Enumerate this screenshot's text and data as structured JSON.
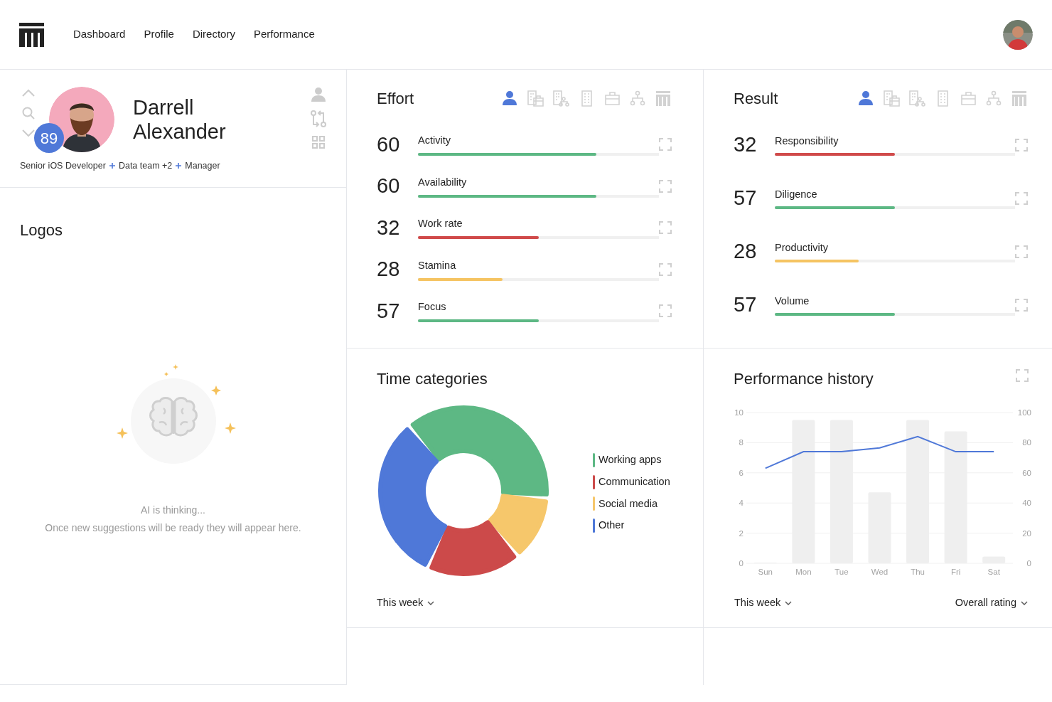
{
  "nav": {
    "items": [
      {
        "label": "Dashboard"
      },
      {
        "label": "Profile"
      },
      {
        "label": "Directory"
      },
      {
        "label": "Performance"
      }
    ]
  },
  "profile": {
    "name": "Darrell Alexander",
    "score": "89",
    "tags": [
      "Senior iOS Developer",
      "Data team +2",
      "Manager"
    ]
  },
  "logos": {
    "title": "Logos",
    "status": "AI is thinking...",
    "message": "Once new suggestions will be ready they will appear here."
  },
  "effort": {
    "title": "Effort",
    "views": [
      {
        "kind": "person",
        "selected": true
      },
      {
        "kind": "office-case",
        "selected": false
      },
      {
        "kind": "office-tree",
        "selected": false
      },
      {
        "kind": "building",
        "selected": false
      },
      {
        "kind": "briefcase",
        "selected": false
      },
      {
        "kind": "tree",
        "selected": false
      },
      {
        "kind": "logo",
        "selected": false
      }
    ],
    "metrics": [
      {
        "value": "60",
        "label": "Activity",
        "level": 0.74,
        "color": "#5db884"
      },
      {
        "value": "60",
        "label": "Availability",
        "level": 0.74,
        "color": "#5db884"
      },
      {
        "value": "32",
        "label": "Work rate",
        "level": 0.5,
        "color": "#d04a4a"
      },
      {
        "value": "28",
        "label": "Stamina",
        "level": 0.35,
        "color": "#f5c462"
      },
      {
        "value": "57",
        "label": "Focus",
        "level": 0.5,
        "color": "#5db884"
      }
    ]
  },
  "result": {
    "title": "Result",
    "views": [
      {
        "kind": "person",
        "selected": true
      },
      {
        "kind": "office-case",
        "selected": false
      },
      {
        "kind": "office-tree",
        "selected": false
      },
      {
        "kind": "building",
        "selected": false
      },
      {
        "kind": "briefcase",
        "selected": false
      },
      {
        "kind": "tree",
        "selected": false
      },
      {
        "kind": "logo",
        "selected": false
      }
    ],
    "metrics": [
      {
        "value": "32",
        "label": "Responsibility",
        "level": 0.5,
        "color": "#d04a4a"
      },
      {
        "value": "57",
        "label": "Diligence",
        "level": 0.5,
        "color": "#5db884"
      },
      {
        "value": "28",
        "label": "Productivity",
        "level": 0.35,
        "color": "#f5c462"
      },
      {
        "value": "57",
        "label": "Volume",
        "level": 0.5,
        "color": "#5db884"
      }
    ]
  },
  "time_categories": {
    "title": "Time categories",
    "legend": [
      {
        "label": "Working apps",
        "color": "#5db884"
      },
      {
        "label": "Communication",
        "color": "#cc4a4a"
      },
      {
        "label": "Social media",
        "color": "#f6c76b"
      },
      {
        "label": "Other",
        "color": "#4f78d8"
      }
    ],
    "period": "This week"
  },
  "performance_history": {
    "title": "Performance history",
    "period": "This week",
    "metric": "Overall rating",
    "hours": {
      "chart_data": {
        "type": "bar",
        "categories": [
          "Sun",
          "Mon",
          "Tue",
          "Wed",
          "Thu",
          "Fri",
          "Sat"
        ],
        "series": [
          {
            "color": "#efefef",
            "values": [
              0,
              9.5,
              9.5,
              4.7,
              9.5,
              8.75,
              0.45
            ]
          }
        ],
        "ylim": [
          0,
          10
        ],
        "yticks": [
          0,
          2,
          4,
          6,
          8,
          10
        ],
        "grid": true
      }
    },
    "rating": {
      "chart_data": {
        "type": "line",
        "series": [
          {
            "color": "#4f78d8",
            "values": [
              63,
              74,
              74,
              76.5,
              84,
              74,
              74
            ]
          }
        ],
        "ylim": [
          0,
          100
        ],
        "yticks": [
          0,
          20,
          40,
          60,
          80,
          100
        ]
      }
    }
  }
}
